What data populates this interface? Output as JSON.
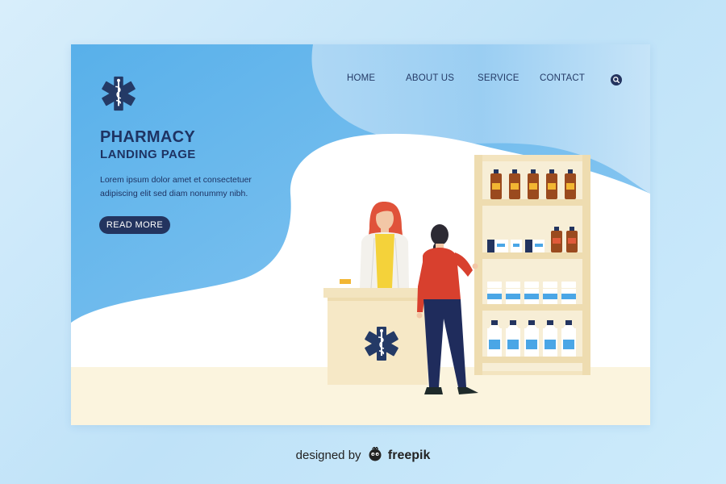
{
  "nav": {
    "items": [
      {
        "label": "HOME"
      },
      {
        "label": "ABOUT US"
      },
      {
        "label": "SERVICE"
      },
      {
        "label": "CONTACT"
      }
    ],
    "search_icon": "search-icon"
  },
  "hero": {
    "title": "PHARMACY",
    "subtitle": "LANDING PAGE",
    "description": "Lorem ipsum dolor amet et consectetuer adipiscing elit sed diam nonummy nibh.",
    "button_label": "READ MORE"
  },
  "footer": {
    "prefix": "designed by",
    "brand": "freepik"
  },
  "icons": {
    "logo": "medical-star-of-life-icon",
    "counter_emblem": "medical-star-of-life-icon"
  },
  "colors": {
    "primary_blue": "#4aa6e6",
    "light_blue": "#a9d3f2",
    "navy": "#23345f",
    "floor": "#fbf4de",
    "counter": "#f6e8c6",
    "pharmacist_hair": "#e0523a",
    "customer_sweater": "#d8402e"
  }
}
